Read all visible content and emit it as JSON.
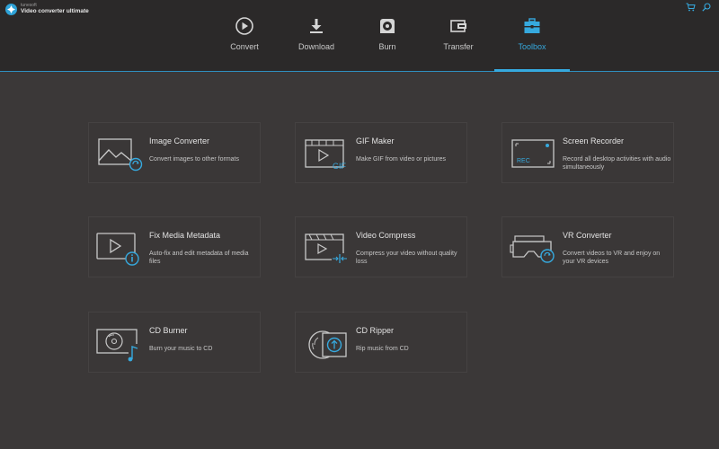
{
  "app": {
    "brand_small": "tunesoft",
    "brand_name": "Video converter ultimate"
  },
  "nav": {
    "tabs": [
      {
        "label": "Convert",
        "icon": "play-circle-icon"
      },
      {
        "label": "Download",
        "icon": "download-icon"
      },
      {
        "label": "Burn",
        "icon": "disc-icon"
      },
      {
        "label": "Transfer",
        "icon": "transfer-icon"
      },
      {
        "label": "Toolbox",
        "icon": "toolbox-icon",
        "active": true
      }
    ]
  },
  "toolbox": {
    "tools": [
      {
        "title": "Image Converter",
        "desc": "Convert images to other formats",
        "icon": "image-convert-icon"
      },
      {
        "title": "GIF Maker",
        "desc": "Make GIF from video or pictures",
        "icon": "gif-icon",
        "icon_text": "GIF"
      },
      {
        "title": "Screen Recorder",
        "desc": "Record all desktop activities with audio simultaneously",
        "icon": "screen-record-icon",
        "icon_text": "REC"
      },
      {
        "title": "Fix Media Metadata",
        "desc": "Auto-fix and edit metadata of media files",
        "icon": "metadata-icon"
      },
      {
        "title": "Video Compress",
        "desc": "Compress your video without quality loss",
        "icon": "compress-icon"
      },
      {
        "title": "VR Converter",
        "desc": "Convert videos to VR and enjoy on your VR devices",
        "icon": "vr-icon"
      },
      {
        "title": "CD Burner",
        "desc": "Burn your music to CD",
        "icon": "cd-burn-icon"
      },
      {
        "title": "CD Ripper",
        "desc": "Rip music from CD",
        "icon": "cd-rip-icon"
      }
    ]
  },
  "colors": {
    "accent": "#36a9de",
    "background": "#3b3838",
    "header": "#2b2929"
  }
}
